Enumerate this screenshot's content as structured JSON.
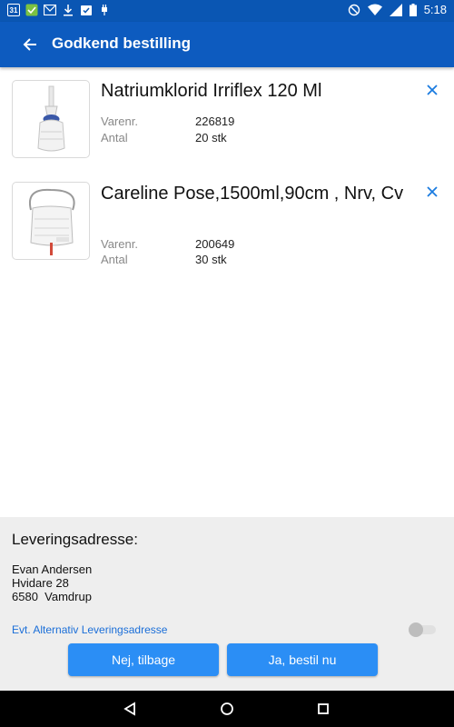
{
  "status_bar": {
    "calendar_day": "31",
    "time": "5:18"
  },
  "app_bar": {
    "title": "Godkend bestilling"
  },
  "products": [
    {
      "name": "Natriumklorid Irriflex 120 Ml",
      "sku_label": "Varenr.",
      "sku": "226819",
      "qty_label": "Antal",
      "qty": "20 stk"
    },
    {
      "name": "Careline Pose,1500ml,90cm , Nrv, Cv",
      "sku_label": "Varenr.",
      "sku": "200649",
      "qty_label": "Antal",
      "qty": "30 stk"
    }
  ],
  "delivery": {
    "title": "Leveringsadresse:",
    "name": "Evan Andersen",
    "street": "Hvidare 28",
    "city": "6580  Vamdrup",
    "alt_label": "Evt. Alternativ Leveringsadresse",
    "alt_enabled": false
  },
  "buttons": {
    "back_label": "Nej, tilbage",
    "confirm_label": "Ja, bestil nu"
  },
  "colors": {
    "status_bar": "#0a56b3",
    "app_bar": "#0d5bbf",
    "accent": "#2b8ef5",
    "link": "#1a6ed8"
  }
}
